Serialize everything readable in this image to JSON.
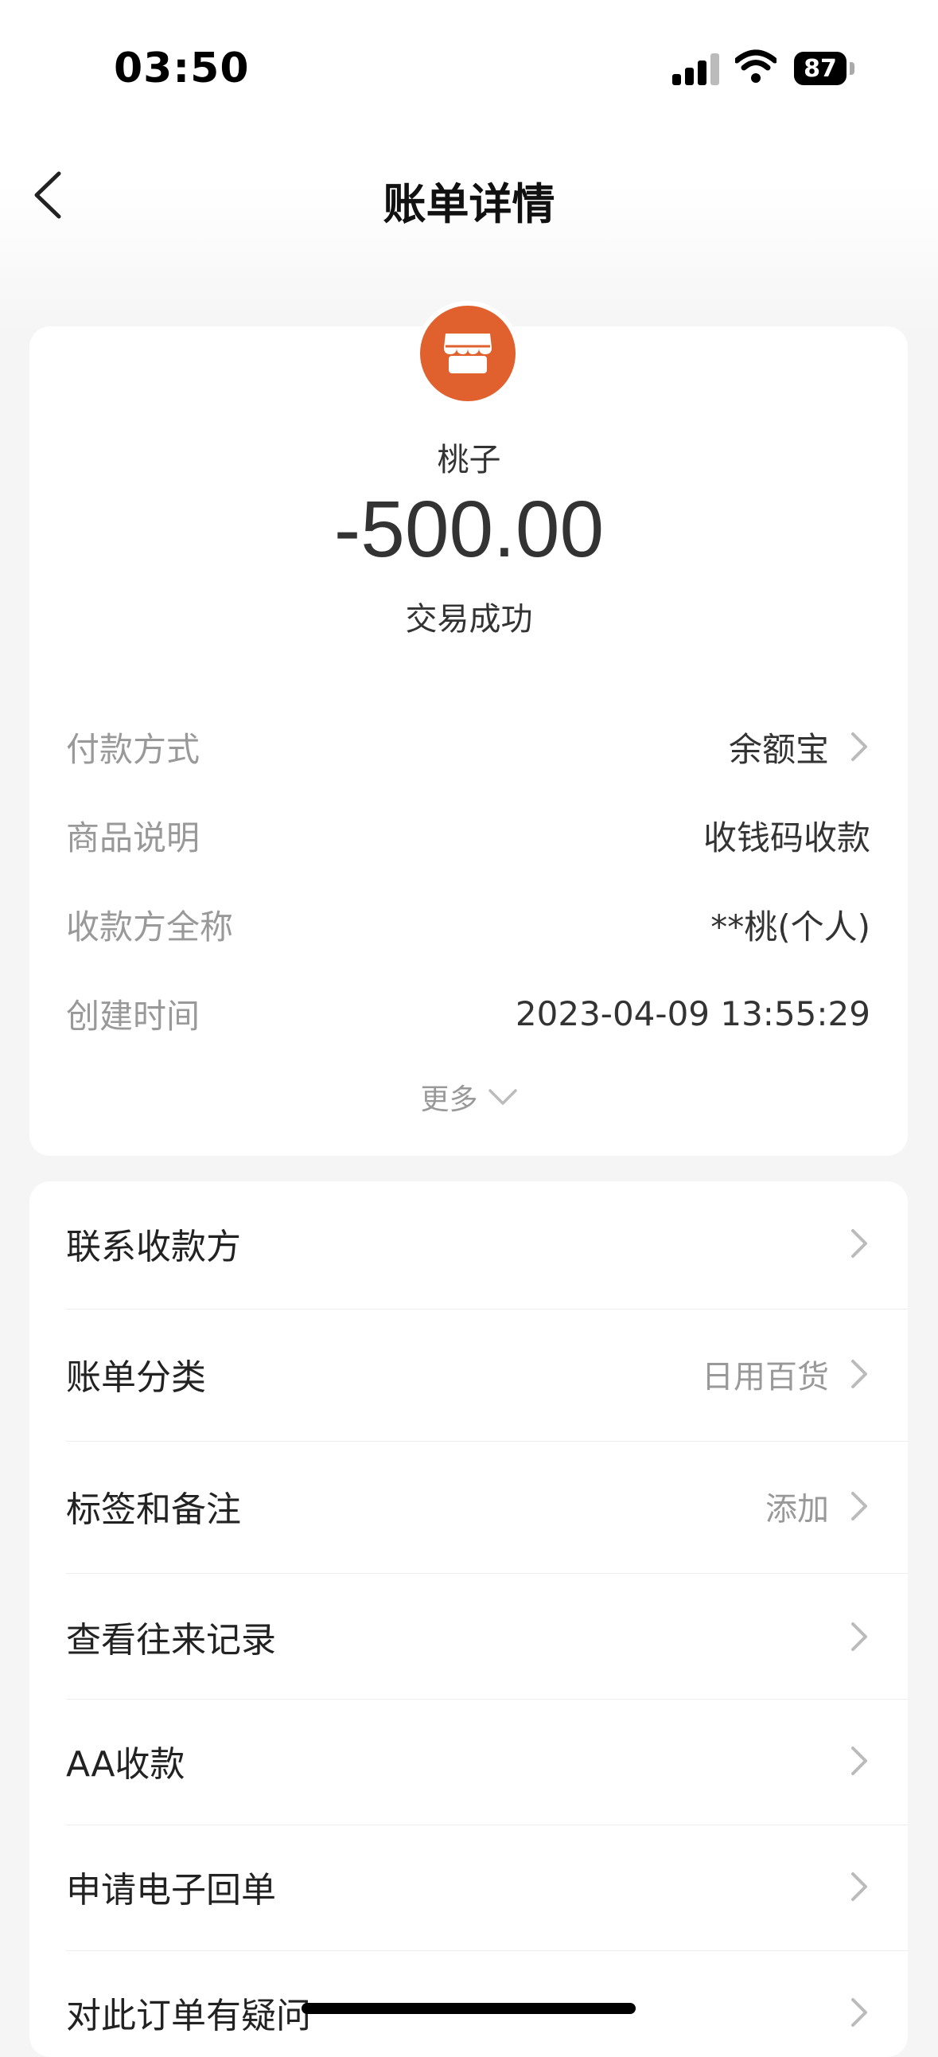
{
  "status_bar": {
    "time": "03:50",
    "battery": "87"
  },
  "nav": {
    "title": "账单详情"
  },
  "summary": {
    "payee": "桃子",
    "amount": "-500.00",
    "status": "交易成功"
  },
  "details": [
    {
      "label": "付款方式",
      "value": "余额宝"
    },
    {
      "label": "商品说明",
      "value": "收钱码收款"
    },
    {
      "label": "收款方全称",
      "value": "**桃(个人)"
    },
    {
      "label": "创建时间",
      "value": "2023-04-09 13:55:29"
    }
  ],
  "more_label": "更多",
  "menu": [
    {
      "label": "联系收款方",
      "value": ""
    },
    {
      "label": "账单分类",
      "value": "日用百货"
    },
    {
      "label": "标签和备注",
      "value": "添加"
    },
    {
      "label": "查看往来记录",
      "value": ""
    },
    {
      "label": "AA收款",
      "value": ""
    },
    {
      "label": "申请电子回单",
      "value": ""
    },
    {
      "label": "对此订单有疑问",
      "value": ""
    }
  ],
  "colors": {
    "avatar": "#e0602e",
    "background": "#f5f5f5"
  }
}
